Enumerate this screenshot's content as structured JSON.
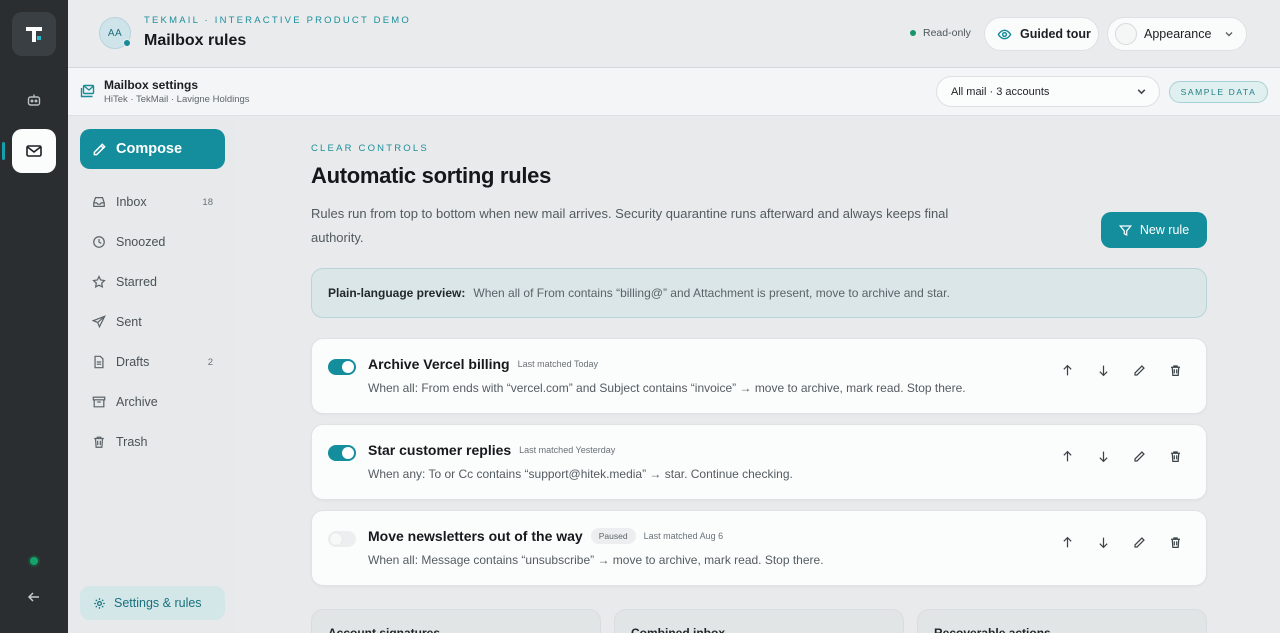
{
  "header": {
    "avatar_initials": "AA",
    "brand": "TEKMAIL · INTERACTIVE PRODUCT DEMO",
    "title": "Mailbox rules",
    "status": "Read-only",
    "guided_tour": "Guided tour",
    "appearance": "Appearance"
  },
  "subheader": {
    "title": "Mailbox settings",
    "accounts": "HiTek · TekMail · Lavigne Holdings",
    "account_filter": "All mail · 3 accounts",
    "badge": "SAMPLE DATA"
  },
  "sidebar": {
    "compose": "Compose",
    "items": [
      {
        "label": "Inbox",
        "count": "18",
        "icon": "inbox-icon"
      },
      {
        "label": "Snoozed",
        "count": "",
        "icon": "clock-icon"
      },
      {
        "label": "Starred",
        "count": "",
        "icon": "star-icon"
      },
      {
        "label": "Sent",
        "count": "",
        "icon": "send-icon"
      },
      {
        "label": "Drafts",
        "count": "2",
        "icon": "draft-icon"
      },
      {
        "label": "Archive",
        "count": "",
        "icon": "archive-icon"
      },
      {
        "label": "Trash",
        "count": "",
        "icon": "trash-icon"
      }
    ],
    "settings": "Settings & rules"
  },
  "main": {
    "eyebrow": "CLEAR CONTROLS",
    "title": "Automatic sorting rules",
    "description": "Rules run from top to bottom when new mail arrives. Security quarantine runs afterward and always keeps final authority.",
    "new_rule": "New rule",
    "preview_label": "Plain-language preview:",
    "preview_text": "When all of From contains “billing@” and Attachment is present, move to archive and star.",
    "rules": [
      {
        "name": "Archive Vercel billing",
        "status": "",
        "last": "Last matched Today",
        "enabled": true,
        "description": "When all: From ends with “vercel.com” and Subject contains “invoice” → move to archive, mark read. Stop there."
      },
      {
        "name": "Star customer replies",
        "status": "",
        "last": "Last matched Yesterday",
        "enabled": true,
        "description": "When any: To or Cc contains “support@hitek.media” → star. Continue checking."
      },
      {
        "name": "Move newsletters out of the way",
        "status": "Paused",
        "last": "Last matched Aug 6",
        "enabled": false,
        "description": "When all: Message contains “unsubscribe” → move to archive, mark read. Stop there."
      }
    ],
    "cards": [
      "Account signatures",
      "Combined inbox",
      "Recoverable actions"
    ]
  },
  "colors": {
    "accent": "#148e9d",
    "rail": "#2a2e31",
    "status_green": "#18946a"
  }
}
